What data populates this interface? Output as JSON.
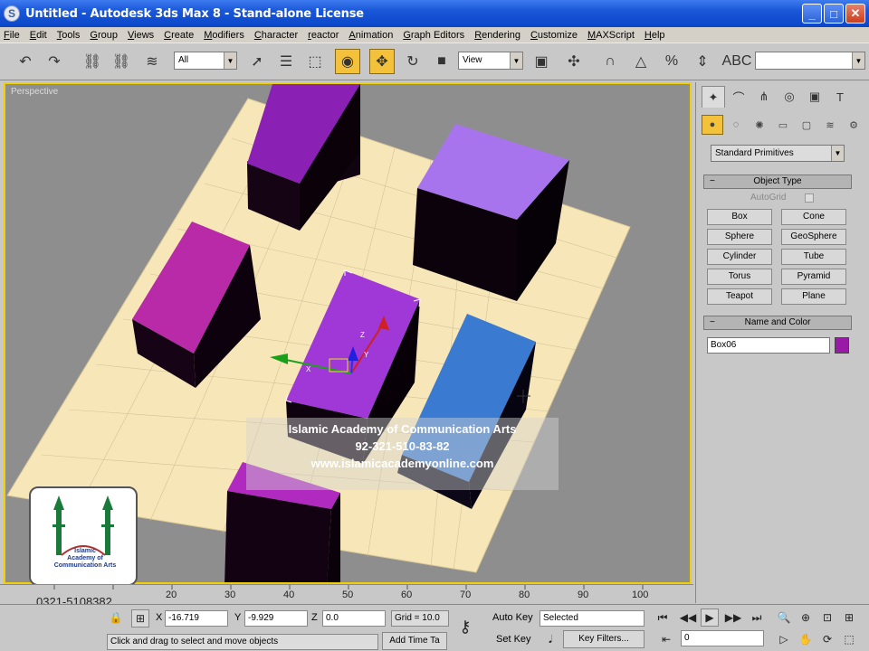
{
  "window": {
    "title": "Untitled   - Autodesk 3ds Max 8  - Stand-alone License",
    "icon": "3ds-max-icon",
    "controls": [
      "_",
      "□",
      "✕"
    ]
  },
  "menu": [
    "File",
    "Edit",
    "Tools",
    "Group",
    "Views",
    "Create",
    "Modifiers",
    "Character",
    "reactor",
    "Animation",
    "Graph Editors",
    "Rendering",
    "Customize",
    "MAXScript",
    "Help"
  ],
  "toolbar": {
    "selection_filter": "All",
    "reference_coord": "View",
    "named_selection": ""
  },
  "viewport": {
    "label": "Perspective",
    "gizmo_axes": {
      "x": "X",
      "y": "Y",
      "z": "Z"
    }
  },
  "watermark": {
    "line1": "Islamic Academy of Communication Arts",
    "line2": "92-321-510-83-82",
    "line3": "www.islamicacademyonline.com"
  },
  "logo": {
    "line1": "Islamic",
    "line2": "Academy of",
    "line3": "Communication Arts"
  },
  "phone": "0321-5108382",
  "command_panel": {
    "category_dropdown": "Standard Primitives",
    "object_type_header": "Object Type",
    "autogrid_label": "AutoGrid",
    "buttons": [
      "Box",
      "Cone",
      "Sphere",
      "GeoSphere",
      "Cylinder",
      "Tube",
      "Torus",
      "Pyramid",
      "Teapot",
      "Plane"
    ],
    "name_color_header": "Name and Color",
    "object_name": "Box06",
    "object_color": "#9a1aa8"
  },
  "timeline": {
    "ticks": [
      "20",
      "30",
      "40",
      "50",
      "60",
      "70",
      "80",
      "90",
      "100"
    ]
  },
  "status": {
    "x_label": "X",
    "x_value": "-16.719",
    "y_label": "Y",
    "y_value": "-9.929",
    "z_label": "Z",
    "z_value": "0.0",
    "grid": "Grid = 10.0",
    "prompt": "Click and drag to select and move objects",
    "add_time_tag": "Add Time Ta",
    "auto_key": "Auto Key",
    "selected": "Selected",
    "set_key": "Set Key",
    "key_filters": "Key Filters...",
    "frame": "0"
  },
  "colors": {
    "ground": "#f7e7b8",
    "box_purple_dark": "#8a20b4",
    "box_lavender": "#a874ee",
    "box_magenta": "#b82aa8",
    "box_blue": "#3a7ad0",
    "viewport_border": "#f0d000"
  }
}
